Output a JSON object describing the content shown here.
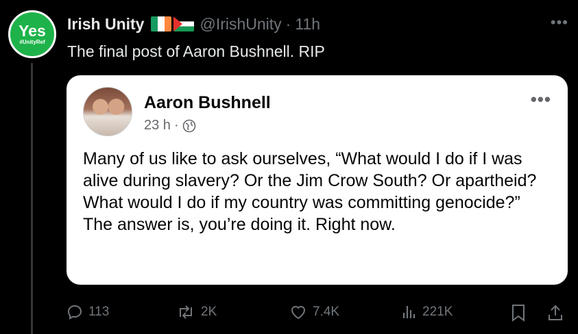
{
  "account": {
    "avatar_main": "Yes",
    "avatar_tag": "#UnityRef",
    "name": "Irish Unity",
    "handle": "@IrishUnity",
    "separator": "·",
    "time": "11h"
  },
  "tweet": {
    "text": "The final post of Aaron Bushnell. RIP"
  },
  "quoted_post": {
    "author": "Aaron Bushnell",
    "time": "23 h",
    "separator": "·",
    "paragraphs": [
      "Many of us like to ask ourselves, “What would I do if I was alive during slavery? Or the Jim Crow South? Or apartheid? What would I do if my country was committing genocide?”",
      "The answer is, you’re doing it. Right now."
    ]
  },
  "actions": {
    "replies": "113",
    "reposts": "2K",
    "likes": "7.4K",
    "views": "221K"
  },
  "colors": {
    "background": "#000000",
    "text": "#e7e9ea",
    "muted": "#71767b",
    "avatar_green": "#1eb34a",
    "card": "#ffffff"
  },
  "icons": [
    "more-icon",
    "reply-icon",
    "repost-icon",
    "like-icon",
    "views-icon",
    "bookmark-icon",
    "share-icon",
    "globe-icon"
  ]
}
